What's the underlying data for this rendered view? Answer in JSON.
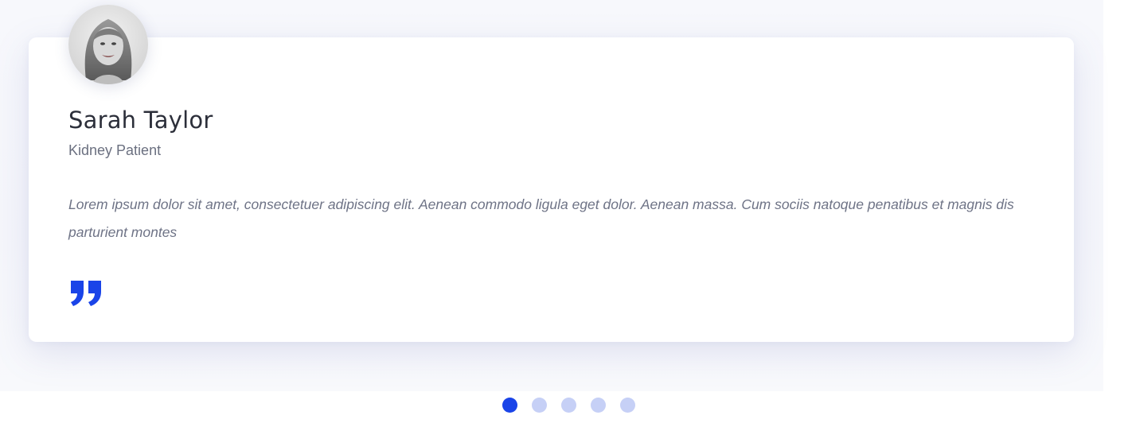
{
  "testimonial": {
    "name": "Sarah Taylor",
    "role": "Kidney Patient",
    "text": "Lorem ipsum dolor sit amet, consectetuer adipiscing elit. Aenean commodo ligula eget dolor. Aenean massa. Cum sociis natoque penatibus et magnis dis parturient montes",
    "avatar_icon": "portrait-photo",
    "quote_icon": "quote-icon"
  },
  "carousel": {
    "page_count": 5,
    "active_index": 0
  },
  "colors": {
    "accent": "#1a44e8",
    "dot_inactive": "#c6d0f6",
    "name_text": "#2c2f3a",
    "body_text": "#6e7386"
  }
}
